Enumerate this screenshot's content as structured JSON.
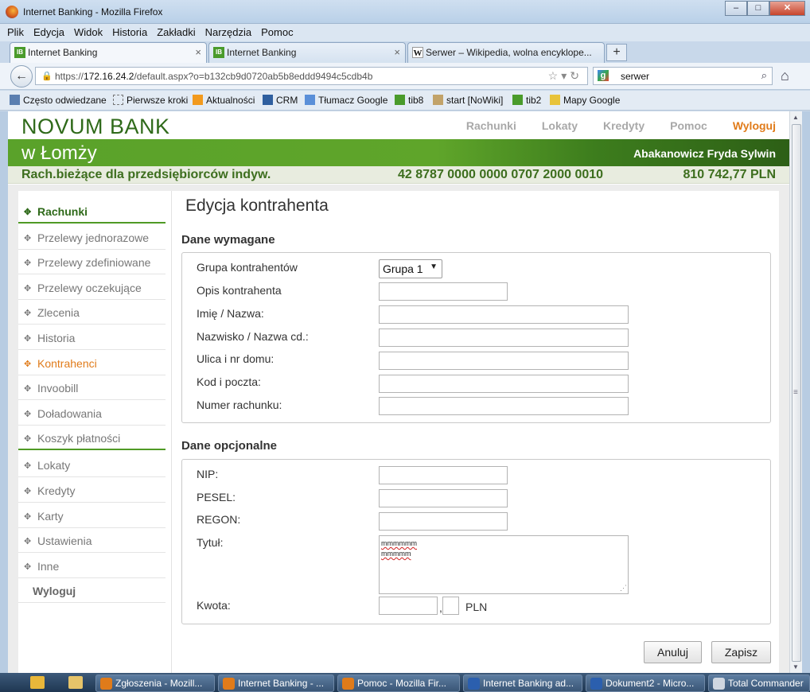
{
  "window": {
    "title": "Internet Banking - Mozilla Firefox",
    "buttons": [
      "–",
      "□",
      "✕"
    ]
  },
  "menu": [
    "Plik",
    "Edycja",
    "Widok",
    "Historia",
    "Zakładki",
    "Narzędzia",
    "Pomoc"
  ],
  "tabs": [
    {
      "label": "Internet Banking",
      "icon": "IB",
      "active": true
    },
    {
      "label": "Internet Banking",
      "icon": "IB",
      "active": false
    },
    {
      "label": "Serwer – Wikipedia, wolna encyklope...",
      "icon": "W",
      "active": false
    }
  ],
  "tab_close": "×",
  "new_tab": "+",
  "address": {
    "scheme": "https://",
    "host": "172.16.24.2",
    "path": "/default.aspx?o=b132cb9d0720ab5b8eddd9494c5cdb4b"
  },
  "search": {
    "value": "serwer"
  },
  "bookmarks": [
    {
      "label": "Często odwiedzane",
      "icon": "bookmark-icon"
    },
    {
      "label": "Pierwsze kroki",
      "icon": "page-icon"
    },
    {
      "label": "Aktualności",
      "icon": "rss-icon"
    },
    {
      "label": "CRM",
      "icon": "crm-icon"
    },
    {
      "label": "Tłumacz Google",
      "icon": "translate-icon"
    },
    {
      "label": "tib8",
      "icon": "ib-icon"
    },
    {
      "label": "start [NoWiki]",
      "icon": "wiki-icon"
    },
    {
      "label": "tib2",
      "icon": "ib-icon"
    },
    {
      "label": "Mapy Google",
      "icon": "maps-icon"
    }
  ],
  "bank": {
    "logo": "NOVUM BANK",
    "city": "w Łomży",
    "user": "Abakanowicz Fryda Sylwin",
    "topnav": [
      "Rachunki",
      "Lokaty",
      "Kredyty",
      "Pomoc",
      "Wyloguj"
    ],
    "account": {
      "name": "Rach.bieżące dla przedsiębiorców indyw.",
      "number": "42 8787 0000 0000 0707 2000 0010",
      "balance": "810 742,77 PLN"
    },
    "brand_green": "#2f6a1a",
    "accent_orange": "#e07b1a"
  },
  "sidebar": {
    "items": [
      {
        "label": "Rachunki",
        "type": "main"
      },
      {
        "label": "Przelewy jednorazowe",
        "type": "sub"
      },
      {
        "label": "Przelewy zdefiniowane",
        "type": "sub"
      },
      {
        "label": "Przelewy oczekujące",
        "type": "sub"
      },
      {
        "label": "Zlecenia",
        "type": "sub"
      },
      {
        "label": "Historia",
        "type": "sub"
      },
      {
        "label": "Kontrahenci",
        "type": "active"
      },
      {
        "label": "Invoobill",
        "type": "sub"
      },
      {
        "label": "Doładowania",
        "type": "sub"
      },
      {
        "label": "Koszyk płatności",
        "type": "sub"
      },
      {
        "label": "Lokaty",
        "type": "sub"
      },
      {
        "label": "Kredyty",
        "type": "sub"
      },
      {
        "label": "Karty",
        "type": "sub"
      },
      {
        "label": "Ustawienia",
        "type": "sub"
      },
      {
        "label": "Inne",
        "type": "sub"
      },
      {
        "label": "Wyloguj",
        "type": "logout"
      }
    ]
  },
  "form": {
    "title": "Edycja kontrahenta",
    "required_title": "Dane wymagane",
    "optional_title": "Dane opcjonalne",
    "required": {
      "group_label": "Grupa kontrahentów",
      "group_value": "Grupa 1",
      "description_label": "Opis kontrahenta",
      "name_label": "Imię / Nazwa:",
      "surname_label": "Nazwisko / Nazwa cd.:",
      "street_label": "Ulica i nr domu:",
      "postcode_label": "Kod i poczta:",
      "account_label": "Numer rachunku:"
    },
    "optional": {
      "nip_label": "NIP:",
      "pesel_label": "PESEL:",
      "regon_label": "REGON:",
      "title_label": "Tytuł:",
      "title_value_lines": [
        "mmmmmm",
        "mmmmm"
      ],
      "amount_label": "Kwota:",
      "amount_separator": ",",
      "currency": "PLN"
    },
    "cancel": "Anuluj",
    "save": "Zapisz"
  },
  "taskbar": [
    {
      "label": "Zgłoszenia - Mozill...",
      "icon": "firefox-icon"
    },
    {
      "label": "Internet Banking - ...",
      "icon": "firefox-icon"
    },
    {
      "label": "Pomoc - Mozilla Fir...",
      "icon": "firefox-icon"
    },
    {
      "label": "Internet Banking ad...",
      "icon": "word-icon"
    },
    {
      "label": "Dokument2 - Micro...",
      "icon": "word-icon"
    },
    {
      "label": "Total Commander",
      "icon": "floppy-icon"
    }
  ]
}
